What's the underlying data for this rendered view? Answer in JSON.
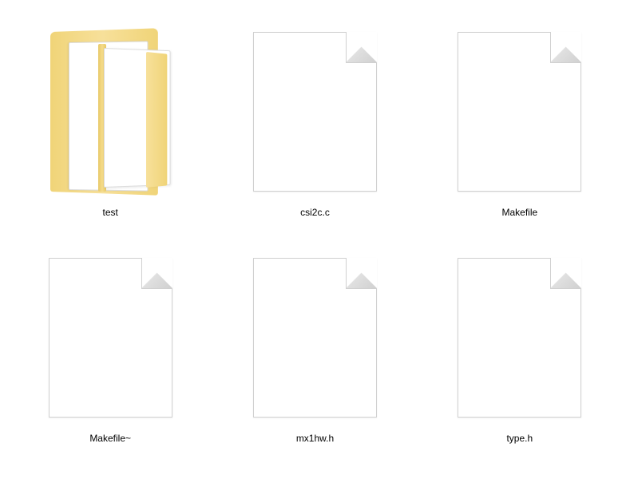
{
  "items": [
    {
      "name": "test",
      "type": "folder"
    },
    {
      "name": "csi2c.c",
      "type": "file"
    },
    {
      "name": "Makefile",
      "type": "file"
    },
    {
      "name": "Makefile~",
      "type": "file"
    },
    {
      "name": "mx1hw.h",
      "type": "file"
    },
    {
      "name": "type.h",
      "type": "file"
    }
  ]
}
